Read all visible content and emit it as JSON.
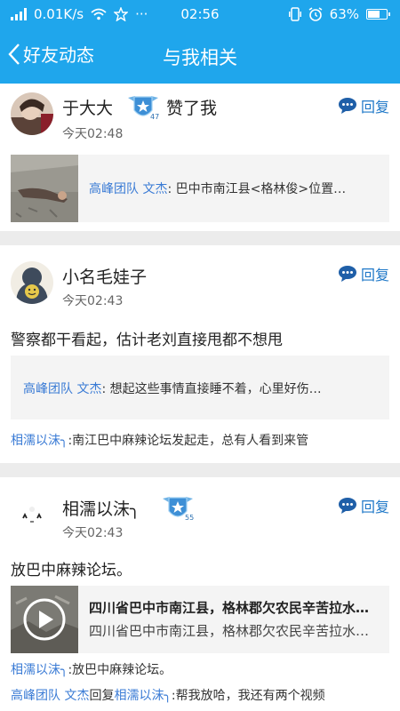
{
  "status": {
    "speed": "0.01K/s",
    "time": "02:56",
    "battery": "63%"
  },
  "nav": {
    "back_label": "好友动态",
    "title": "与我相关"
  },
  "cards": [
    {
      "user": "于大大",
      "action": "赞了我",
      "time": "今天02:48",
      "reply": "回复",
      "badge_level": "47",
      "quote": {
        "group": "高峰团队 文杰",
        "sep": ":",
        "text": "巴中市南江县<格林俊>位置…"
      }
    },
    {
      "user": "小名毛娃子",
      "time": "今天02:43",
      "reply": "回复",
      "text": "警察都干看起，估计老刘直接甩都不想甩",
      "quote": {
        "group": "高峰团队 文杰",
        "sep": ":",
        "text": "想起这些事情直接睡不着，心里好伤…"
      },
      "comment": {
        "name": "相濡以沫╮",
        "text": ":南江巴中麻辣论坛发起走，总有人看到来管"
      }
    },
    {
      "user": "相濡以沫╮",
      "time": "今天02:43",
      "reply": "回复",
      "badge_level": "55",
      "text": "放巴中麻辣论坛。",
      "quote": {
        "line1": "四川省巴中市南江县，格林郡欠农民辛苦拉水…",
        "line2": "四川省巴中市南江县，格林郡欠农民辛苦拉水…"
      },
      "comment1": {
        "name": "相濡以沫╮",
        "text": ":放巴中麻辣论坛。"
      },
      "comment2": {
        "name": "高峰团队 文杰",
        "mid": "回复",
        "name2": "相濡以沫╮",
        "text": ":帮我放哈，我还有两个视频"
      }
    }
  ]
}
